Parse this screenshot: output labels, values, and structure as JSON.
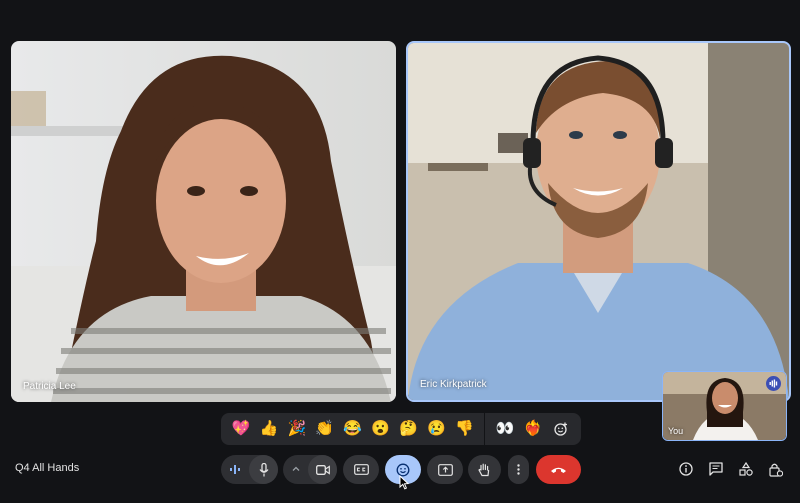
{
  "meeting": {
    "title": "Q4 All Hands"
  },
  "participants": [
    {
      "name": "Patricia Lee"
    },
    {
      "name": "Eric Kirkpatrick"
    },
    {
      "name": "You"
    }
  ],
  "reactions": [
    "💖",
    "👍",
    "🎉",
    "👏",
    "😂",
    "😮",
    "🤔",
    "😢",
    "👎",
    "👀",
    "❤️‍🔥"
  ],
  "colors": {
    "background": "#121316",
    "active_speaker_border": "#a8c7fa",
    "reactions_button_active": "#a8c7fa",
    "end_call": "#dc362e"
  }
}
